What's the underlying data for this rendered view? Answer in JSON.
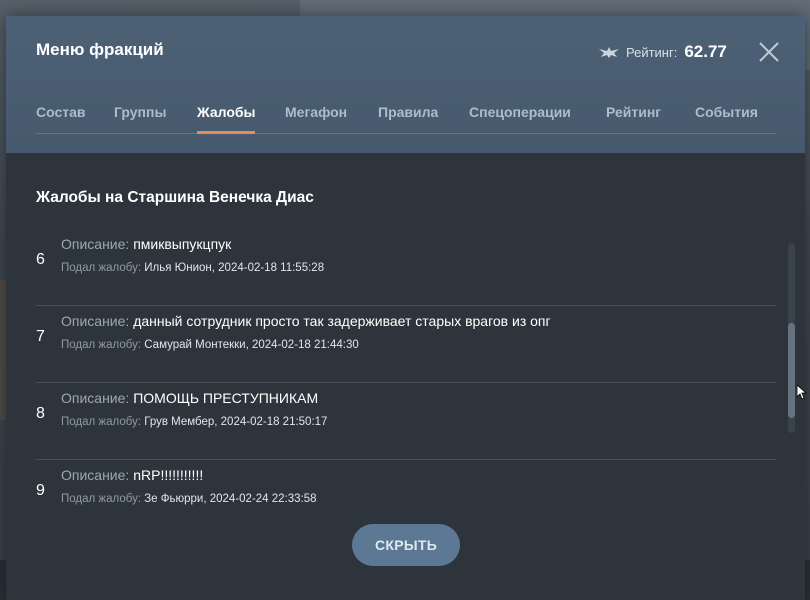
{
  "window": {
    "title": "Меню фракций",
    "rating_label": "Рейтинг:",
    "rating_value": "62.77"
  },
  "tabs": [
    {
      "label": "Состав",
      "active": false
    },
    {
      "label": "Группы",
      "active": false
    },
    {
      "label": "Жалобы",
      "active": true
    },
    {
      "label": "Мегафон",
      "active": false
    },
    {
      "label": "Правила",
      "active": false
    },
    {
      "label": "Спецоперации",
      "active": false
    },
    {
      "label": "Рейтинг",
      "active": false
    },
    {
      "label": "События",
      "active": false
    }
  ],
  "complaints": {
    "title": "Жалобы на Старшина Венечка Диас",
    "description_label": "Описание:",
    "filed_by_label": "Подал жалобу:",
    "items": [
      {
        "number": "6",
        "description": "пмиквыпукцпук",
        "filed_by": "Илья Юнион, 2024-02-18 11:55:28"
      },
      {
        "number": "7",
        "description": "данный сотрудник просто так задерживает старых врагов из опг",
        "filed_by": "Самурай Монтекки, 2024-02-18 21:44:30"
      },
      {
        "number": "8",
        "description": "ПОМОЩЬ ПРЕСТУПНИКАМ",
        "filed_by": "Грув Мембер, 2024-02-18 21:50:17"
      },
      {
        "number": "9",
        "description": "nRP!!!!!!!!!!!",
        "filed_by": "Зе Фьюрри, 2024-02-24 22:33:58"
      }
    ]
  },
  "buttons": {
    "hide_label": "СКРЫТЬ"
  },
  "colors": {
    "accent": "#e88a5c",
    "header_bg": "#4d6176",
    "panel_bg": "#2e343b",
    "button_bg": "#5d7894"
  },
  "icons": {
    "rating": "rating-wing-icon",
    "close": "close-icon"
  }
}
